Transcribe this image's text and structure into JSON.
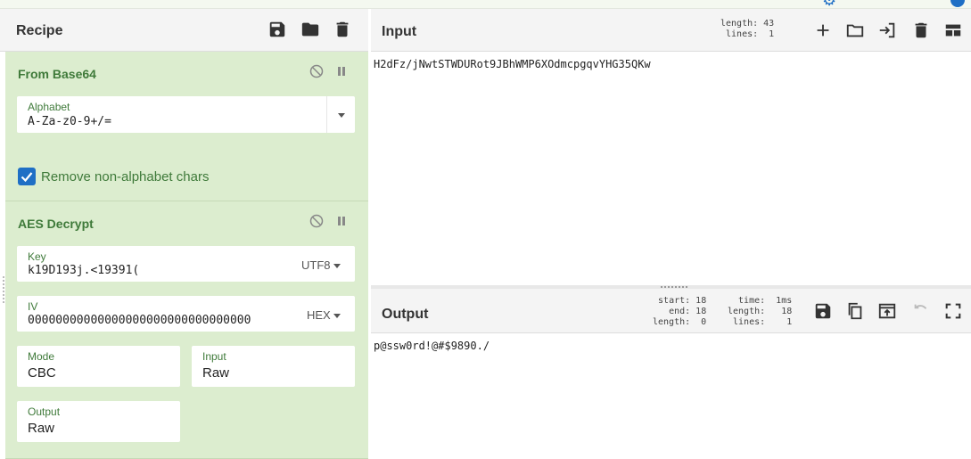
{
  "recipe": {
    "title": "Recipe",
    "operations": [
      {
        "name": "From Base64",
        "alphabet_label": "Alphabet",
        "alphabet_value": "A-Za-z0-9+/=",
        "remove_checkbox_label": "Remove non-alphabet chars",
        "remove_checked": true
      },
      {
        "name": "AES Decrypt",
        "key_label": "Key",
        "key_value": "k19D193j.<19391(",
        "key_encoding": "UTF8",
        "iv_label": "IV",
        "iv_value": "00000000000000000000000000000000",
        "iv_encoding": "HEX",
        "mode_label": "Mode",
        "mode_value": "CBC",
        "input_label": "Input",
        "input_value": "Raw",
        "output_label": "Output",
        "output_value": "Raw"
      }
    ]
  },
  "input": {
    "title": "Input",
    "stats": "length: 43\n lines:  1",
    "text": "H2dFz/jNwtSTWDURot9JBhWMP6XOdmcpgqvYHG35QKw"
  },
  "output": {
    "title": "Output",
    "stats_left": "start: 18\n  end: 18\nlength:  0",
    "stats_right": "  time:  1ms\nlength:   18\n lines:    1",
    "text": "p@ssw0rd!@#$9890./"
  },
  "colors": {
    "accent_blue": "#1f6fc5",
    "op_background": "#dcedcf",
    "op_label_green": "#3f7a3a"
  },
  "icons": [
    "save-icon",
    "folder-icon",
    "trash-icon",
    "disable-icon",
    "pause-icon",
    "plus-icon",
    "import-icon",
    "layout-icon",
    "copy-icon",
    "replace-input-icon",
    "undo-icon",
    "fullscreen-icon"
  ]
}
